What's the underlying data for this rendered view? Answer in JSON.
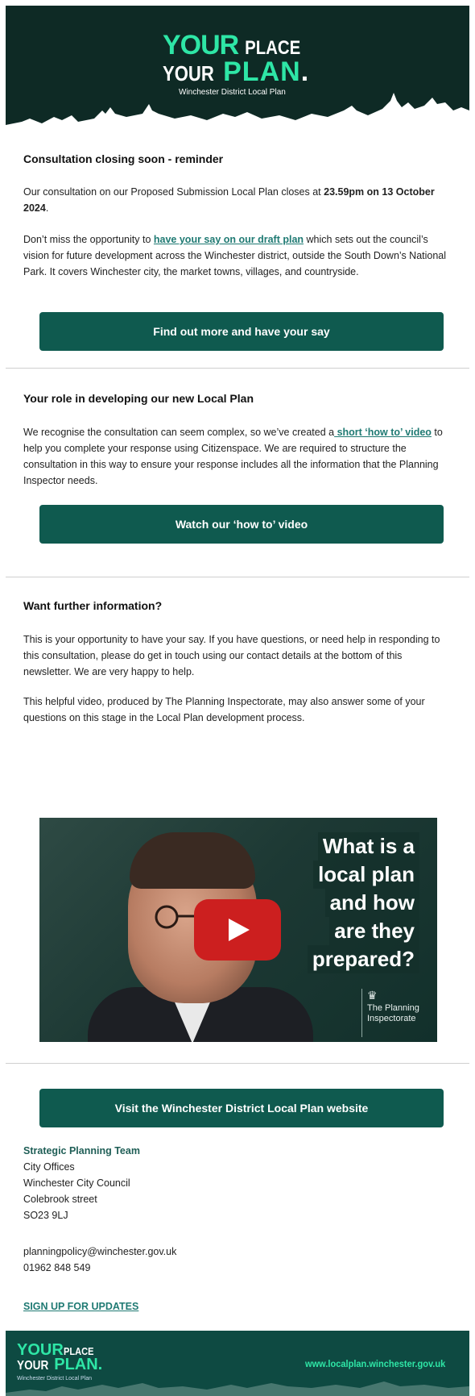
{
  "header": {
    "logo_line1_your": "YOUR",
    "logo_line1_place": "PLACE",
    "logo_line2_your": "YOUR",
    "logo_line2_plan": "PLAN",
    "logo_dot": ".",
    "logo_subtitle": "Winchester District Local Plan"
  },
  "section1": {
    "heading": "Consultation closing soon - reminder",
    "p1_a": "Our consultation on our Proposed Submission Local Plan closes at ",
    "p1_bold": "23.59pm on 13 October 2024",
    "p1_end": ".",
    "p2_a": "Don’t miss the opportunity to ",
    "p2_link": "have your say on our draft plan",
    "p2_b": " which sets out the council’s vision for future development across the Winchester district, outside the South Down’s National Park. It covers Winchester city, the market towns, villages, and countryside.",
    "button": "Find out more and have your say"
  },
  "section2": {
    "heading": "Your role in developing our new Local Plan",
    "p1_a": "We recognise the consultation can seem complex, so we’ve created a",
    "p1_link": " short ‘how to’ video",
    "p1_b": " to help you complete your response using Citizenspace. We are required to structure the consultation in this way to ensure your response includes all the information that the Planning Inspector needs.",
    "button": "Watch our ‘how to’ video"
  },
  "section3": {
    "heading": "Want further information?",
    "p1": "This is your opportunity to have your say. If you have questions, or need help in responding to this consultation, please do get in touch using our contact details at the bottom of this newsletter. We are very happy to help.",
    "p2": "This helpful video, produced by The Planning Inspectorate, may also answer some of your questions on this stage in the Local Plan development process.",
    "video": {
      "line1": "What is a",
      "line2": "local plan",
      "line3": "and how",
      "line4": "are they",
      "line5": "prepared?",
      "brand_line1": "The Planning",
      "brand_line2": "Inspectorate"
    }
  },
  "cta": {
    "button": "Visit the Winchester District Local Plan website"
  },
  "address": {
    "team": "Strategic Planning Team",
    "line1": "City Offices",
    "line2": "Winchester City Council",
    "line3": "Colebrook street",
    "line4": "SO23 9LJ"
  },
  "contact": {
    "email": "planningpolicy@winchester.gov.uk",
    "phone": "01962 848 549"
  },
  "signup": "SIGN UP FOR UPDATES",
  "footer": {
    "logo_line1_your": "YOUR",
    "logo_line1_place": "PLACE",
    "logo_line2_your": "YOUR",
    "logo_line2_plan": "PLAN.",
    "logo_subtitle": "Winchester District Local Plan",
    "url": "www.localplan.winchester.gov.uk"
  },
  "colors": {
    "header_bg": "#0e2a25",
    "accent_green": "#2ee6a6",
    "button_bg": "#0f5a4f",
    "link": "#1f7a73",
    "footer_bg": "#0e4a42",
    "play_button": "#cc1f1f"
  },
  "icons": [
    "skyline-graphic",
    "youtube-play-icon",
    "royal-crest-icon"
  ]
}
